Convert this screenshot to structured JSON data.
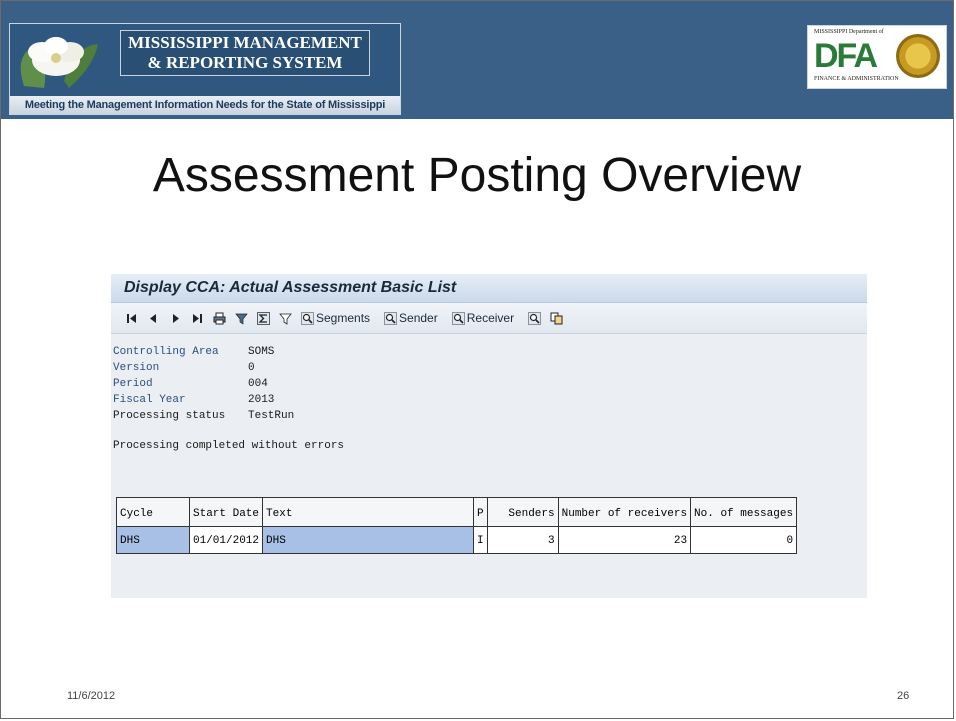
{
  "header": {
    "logo_title_line1": "MISSISSIPPI MANAGEMENT",
    "logo_title_line2": "& REPORTING SYSTEM",
    "tagline": "Meeting the Management Information Needs for the State of Mississippi",
    "dfa_top": "MISSISSIPPI Department of",
    "dfa_letters": "DFA",
    "dfa_bottom": "FINANCE & ADMINISTRATION"
  },
  "slide": {
    "title": "Assessment Posting Overview",
    "date": "11/6/2012",
    "page_number": "26"
  },
  "sap": {
    "window_title": "Display CCA: Actual Assessment Basic List",
    "toolbar": {
      "segments_label": "Segments",
      "sender_label": "Sender",
      "receiver_label": "Receiver"
    },
    "info": [
      {
        "label": "Controlling Area",
        "value": "SOMS"
      },
      {
        "label": "Version",
        "value": "0"
      },
      {
        "label": "Period",
        "value": "004"
      },
      {
        "label": "Fiscal Year",
        "value": "2013"
      },
      {
        "label": "Processing status",
        "value": "TestRun"
      }
    ],
    "message": "Processing completed without errors",
    "table": {
      "headers": [
        "Cycle",
        "Start Date",
        "Text",
        "P",
        "Senders",
        "Number of receivers",
        "No. of messages"
      ],
      "rows": [
        [
          "DHS",
          "01/01/2012",
          "DHS",
          "I",
          "3",
          "23",
          "0"
        ]
      ]
    }
  },
  "colors": {
    "header_bar": "#3a6088",
    "selection": "#a9c0e6"
  }
}
